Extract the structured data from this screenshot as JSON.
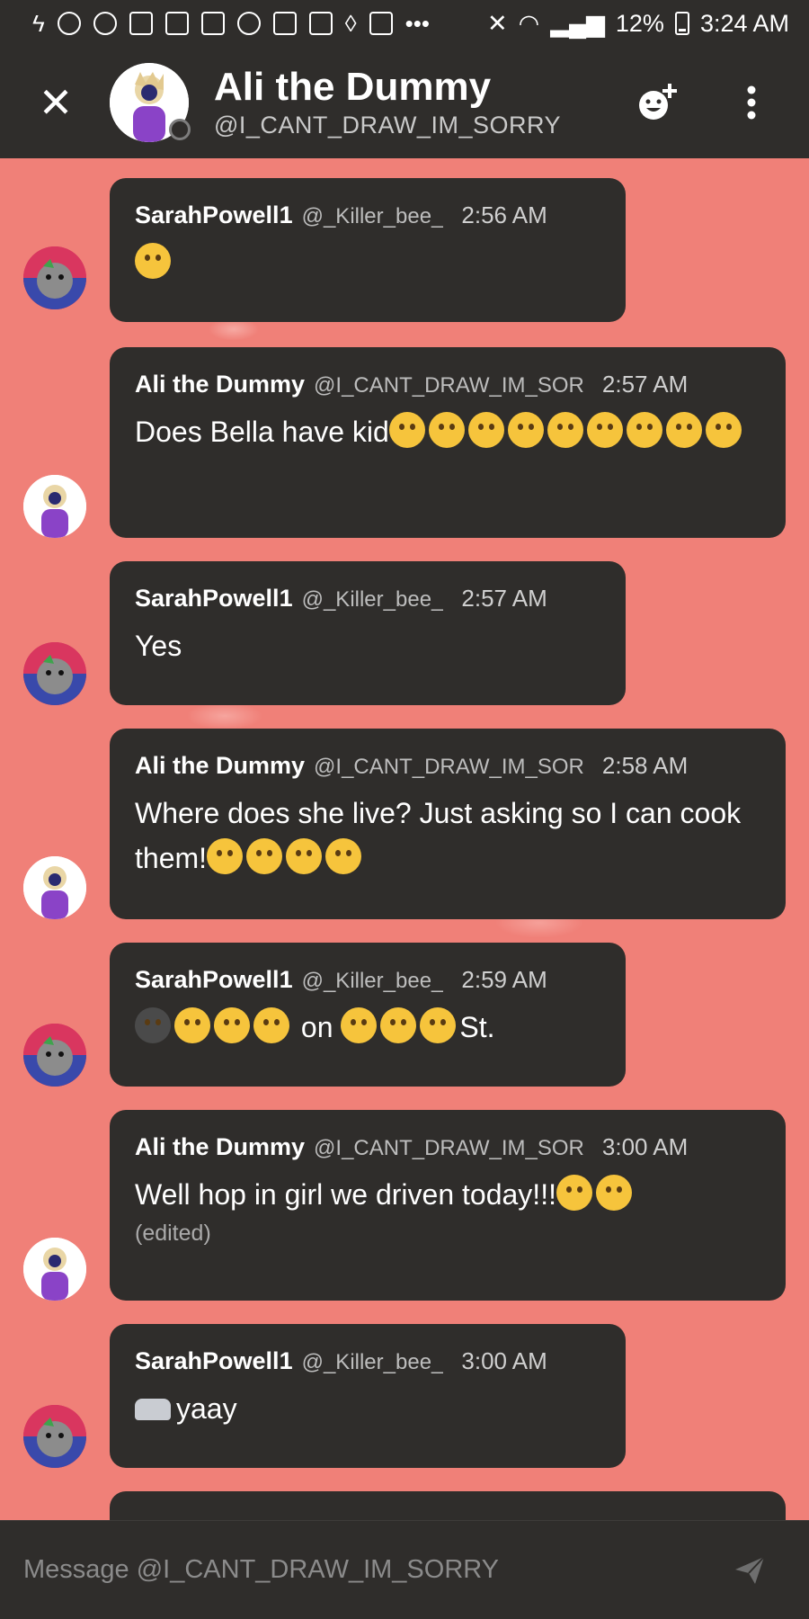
{
  "status_bar": {
    "battery": "12%",
    "time": "3:24 AM"
  },
  "header": {
    "name": "Ali the Dummy",
    "handle": "@I_CANT_DRAW_IM_SORRY"
  },
  "messages": [
    {
      "author": "SarahPowell1",
      "handle": "@_Killer_bee_",
      "time": "2:56 AM",
      "text": "",
      "emoji": [
        "smiling-face-with-smiling-eyes"
      ]
    },
    {
      "author": "Ali the Dummy",
      "handle": "@I_CANT_DRAW_IM_SOR",
      "time": "2:57 AM",
      "text": "Does Bella have kid"
    },
    {
      "author": "SarahPowell1",
      "handle": "@_Killer_bee_",
      "time": "2:57 AM",
      "text": "Yes"
    },
    {
      "author": "Ali the Dummy",
      "handle": "@I_CANT_DRAW_IM_SOR",
      "time": "2:58 AM",
      "text": "Where does she live? Just asking so I can cook them!"
    },
    {
      "author": "SarahPowell1",
      "handle": "@_Killer_bee_",
      "time": "2:59 AM",
      "text_mid": "on",
      "text_end": "St."
    },
    {
      "author": "Ali the Dummy",
      "handle": "@I_CANT_DRAW_IM_SOR",
      "time": "3:00 AM",
      "text": "Well hop in girl we driven today!!!",
      "edited": "(edited)"
    },
    {
      "author": "SarahPowell1",
      "handle": "@_Killer_bee_",
      "time": "3:00 AM",
      "text": "yaay"
    }
  ],
  "input": {
    "placeholder": "Message @I_CANT_DRAW_IM_SORRY"
  },
  "colors": {
    "background": "#f08078",
    "bubble": "#2f2d2b",
    "header": "#2f2d2b"
  }
}
